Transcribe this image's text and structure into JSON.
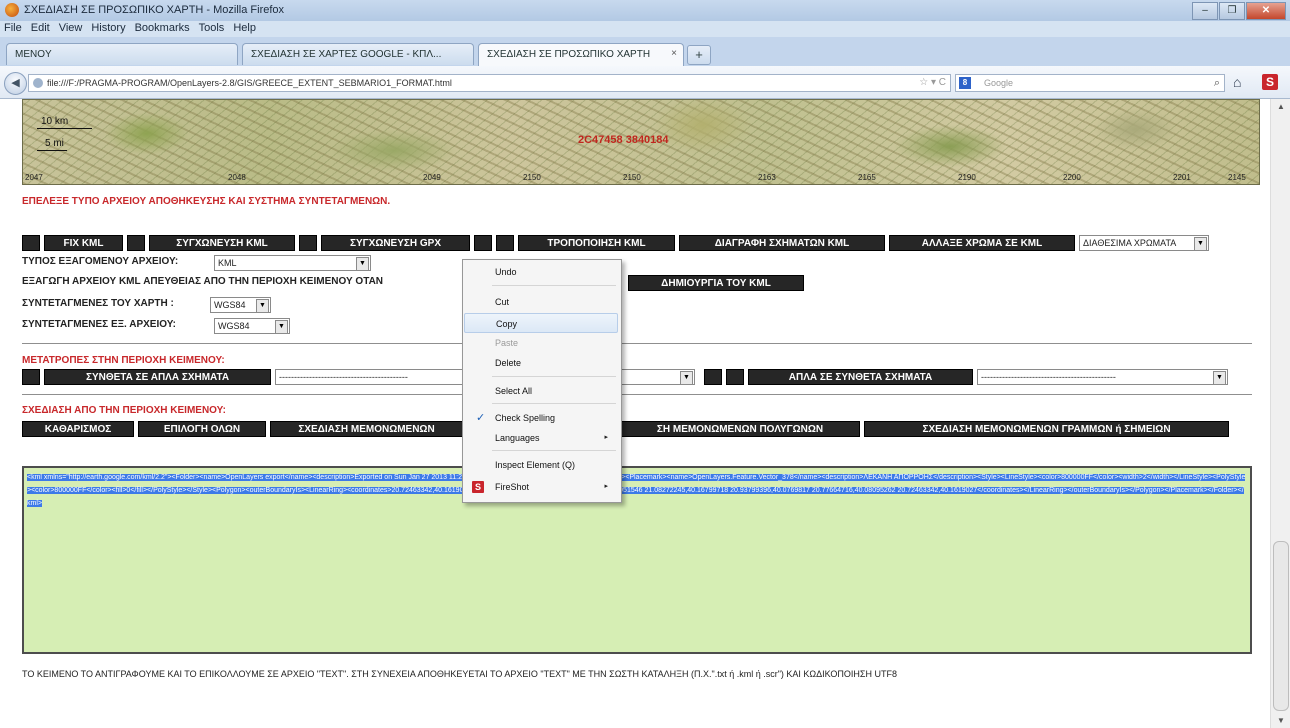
{
  "window": {
    "title": "ΣΧΕΔΙΑΣΗ ΣΕ ΠΡΟΣΩΠΙΚΟ ΧΑΡΤΗ - Mozilla Firefox",
    "buttons": [
      "–",
      "❐",
      "✕"
    ]
  },
  "menubar": [
    "File",
    "Edit",
    "View",
    "History",
    "Bookmarks",
    "Tools",
    "Help"
  ],
  "tabs": [
    {
      "label": "MENOY"
    },
    {
      "label": "ΣΧΕΔΙΑΣΗ ΣΕ ΧΑΡΤΕΣ GOOGLE - ΚΠΛ..."
    },
    {
      "label": "ΣΧΕΔΙΑΣΗ ΣΕ ΠΡΟΣΩΠΙΚΟ ΧΑΡΤΗ",
      "close": "×"
    }
  ],
  "new_tab_label": "+",
  "url": "file:///F:/PRAGMA-PROGRAM/OpenLayers-2.8/GIS/GREECE_EXTENT_SEBMARIO1_FORMAT.html",
  "url_right": "☆ ▾ C",
  "search": {
    "engine": "8",
    "placeholder": "Google",
    "icon": "⌕"
  },
  "map": {
    "scale_km": "10 km",
    "scale_mi": "5 mi",
    "coords": "2C47458 3840184",
    "grid_labels": [
      "2047",
      "2048",
      "2049",
      "2150",
      "2150",
      "2163",
      "2165",
      "2190",
      "2200",
      "2201",
      "2145"
    ]
  },
  "heading_select": "ΕΠΕΛΕΞΕ ΤΥΠΟ ΑΡΧΕΙΟΥ ΑΠΟΘΗΚΕΥΣΗΣ ΚΑΙ ΣΥΣΤΗΜΑ ΣΥΝΤΕΤΑΓΜΕΝΩΝ.",
  "toolbar1": {
    "fix_kml": "FIX KML",
    "merge_kml": "ΣΥΓΧΩΝΕΥΣΗ KML",
    "merge_gpx": "ΣΥΓΧΩΝΕΥΣΗ GPX",
    "modify_kml": "ΤΡΟΠΟΠΟΙΗΣΗ KML",
    "delete_shapes": "ΔΙΑΓΡΑΦΗ ΣΧΗΜΑΤΩΝ KML",
    "change_color": "ΑΛΛΑΞΕ ΧΡΩΜΑ ΣΕ KML",
    "colors_select": "ΔΙΑΘΕΣΙΜΑ ΧΡΩΜΑΤΑ"
  },
  "form": {
    "file_type_label": "ΤΥΠΟΣ ΕΞΑΓΟΜΕΝΟΥ ΑΡΧΕΙΟΥ:",
    "file_type_value": "KML",
    "export_label": "ΕΞΑΓΩΓΗ ΑΡΧΕΙΟΥ KML ΑΠΕΥΘΕΙΑΣ ΑΠΟ ΤΗΝ ΠΕΡΙΟΧΗ ΚΕΙΜΕΝΟΥ ΟΤΑΝ",
    "create_kml": "ΔΗΜΙΟΥΡΓΙΑ ΤΟΥ KML",
    "map_coords_label": "ΣΥΝΤΕΤΑΓΜΕΝΕΣ ΤΟΥ ΧΑΡΤΗ :",
    "map_coords_value": "WGS84",
    "file_coords_label": "ΣΥΝΤΕΤΑΓΜΕΝΕΣ ΕΞ. ΑΡΧΕΙΟΥ:",
    "file_coords_value": "WGS84"
  },
  "heading_convert": "ΜΕΤΑΤΡΟΠΕΣ ΣΤΗΝ ΠΕΡΙΟΧΗ ΚΕΙΜΕΝΟΥ:",
  "toolbar2": {
    "compound_to_simple": "ΣΥΝΘΕΤΑ ΣΕ ΑΠΛΑ ΣΧΗΜΑΤΑ",
    "select1": "-------------------------------------------",
    "simple_to_compound": "ΑΠΛΑ ΣΕ ΣΥΝΘΕΤΑ ΣΧΗΜΑΤΑ",
    "select2": "---------------------------------------------"
  },
  "heading_draw": "ΣΧΕΔΙΑΣΗ ΑΠΟ ΤΗΝ ΠΕΡΙΟΧΗ ΚΕΙΜΕΝΟΥ:",
  "toolbar3": {
    "clear": "ΚΑΘΑΡΙΣΜΟΣ",
    "select_all": "ΕΠΙΛΟΓΗ ΟΛΩΝ",
    "draw_single_polygons": "ΣΧΕΔΙΑΣΗ ΜΕΜΟΝΩΜΕΝΩΝ",
    "draw_single_polygons_2": "ΣΗ ΜΕΜΟΝΩΜΕΝΩΝ ΠΟΛΥΓΩΝΩΝ",
    "draw_single_lines": "ΣΧΕΔΙΑΣΗ ΜΕΜΟΝΩΜΕΝΩΝ ΓΡΑΜΜΩΝ ή ΣΗΜΕΙΩΝ"
  },
  "textarea": {
    "content": "<kml xmlns=\"http://earth.google.com/kml/2.2\"><Folder><name>OpenLayers export</name><description>Exported on Sun Jan 27 2013 11:22:14 GMT+0200 (GTB Standard Time)</description><Placemark><name>OpenLayers.Feature.Vector_378</name><description>ΛΕΚΑΝΗ ΑΠΟΡΡΟΗΣ</description><Style><LineStyle><color>800000FF</color><width>2</width></LineStyle><PolyStyle><color>800000FF</color><fill>0</fill></PolyStyle></Style><Polygon><outerBoundaryIs><LinearRing><coordinates>20.72463342,40.1619027 20.78164936,40.16793616 20.95166994,40.35951546 21.08272245,40.16799718 20.93799396,40.0769817 20.77664716,40.08095262 20.72463342,40.1619027</coordinates></LinearRing></outerBoundaryIs></Polygon></Placemark></Folder></kml>"
  },
  "footer": "ΤΟ ΚΕΙΜΕΝΟ ΤΟ ΑΝΤΙΓΡΑΦΟΥΜΕ ΚΑΙ ΤΟ ΕΠΙΚΟΛΛΟΥΜΕ ΣΕ ΑΡΧΕΙΟ \"TEXT\". ΣΤΗ ΣΥΝΕΧΕΙΑ ΑΠΟΘΗΚΕΥΕΤΑΙ ΤΟ ΑΡΧΕΙΟ \"TEXT\" ΜΕ ΤΗΝ ΣΩΣΤΗ ΚΑΤΑΛΗΞΗ (Π.Χ.\".txt ή .kml ή .scr\") ΚΑΙ ΚΩΔΙΚΟΠΟΙΗΣΗ UTF8",
  "context_menu": {
    "undo": "Undo",
    "cut": "Cut",
    "copy": "Copy",
    "paste": "Paste",
    "delete": "Delete",
    "select_all": "Select All",
    "check_spelling": "Check Spelling",
    "languages": "Languages",
    "inspect": "Inspect Element (Q)",
    "fireshot": "FireShot",
    "check_mark": "✓",
    "submenu_arrow": "▸",
    "fireshot_icon": "S"
  },
  "colors": {
    "accent_red": "#c8282b",
    "button_bg": "#262626",
    "textarea_bg": "#d6eeb4",
    "selection": "#3d7ae8"
  }
}
